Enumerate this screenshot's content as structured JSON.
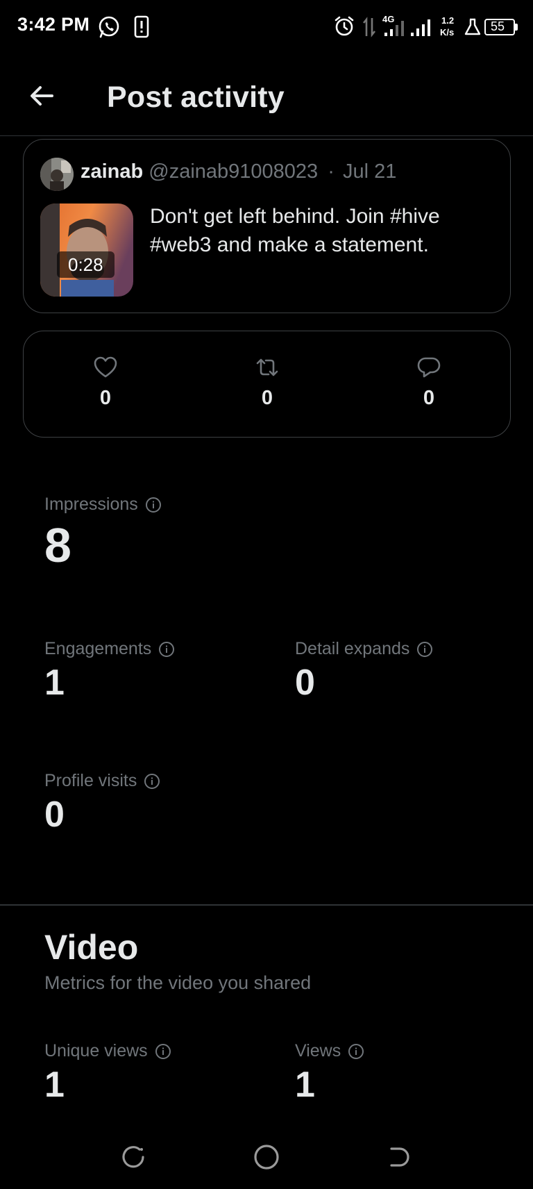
{
  "status_bar": {
    "time": "3:42 PM",
    "network": "4G",
    "speed_value": "1.2",
    "speed_unit": "K/s",
    "battery": "55",
    "icons": [
      "whatsapp-icon",
      "sim-alert-icon",
      "alarm-icon",
      "data-arrows-icon",
      "signal-icon",
      "signal-icon",
      "flask-icon",
      "battery-icon"
    ]
  },
  "header": {
    "title": "Post activity",
    "back_icon": "arrow-left-icon"
  },
  "post": {
    "author_name": "zainab",
    "handle": "@zainab91008023",
    "separator": "·",
    "date": "Jul 21",
    "video_duration": "0:28",
    "text": "Don't get left behind. Join #hive #web3 and make a statement."
  },
  "engagement": {
    "likes": "0",
    "reposts": "0",
    "replies": "0",
    "icons": [
      "heart-icon",
      "repost-icon",
      "reply-icon"
    ]
  },
  "metrics": {
    "impressions": {
      "label": "Impressions",
      "value": "8"
    },
    "engagements": {
      "label": "Engagements",
      "value": "1"
    },
    "detail_expands": {
      "label": "Detail expands",
      "value": "0"
    },
    "profile_visits": {
      "label": "Profile visits",
      "value": "0"
    }
  },
  "video_section": {
    "title": "Video",
    "subtitle": "Metrics for the video you shared",
    "unique_views": {
      "label": "Unique views",
      "value": "1"
    },
    "views": {
      "label": "Views",
      "value": "1"
    }
  },
  "nav_bar": {
    "icons": [
      "recents-icon",
      "home-circle-icon",
      "back-nav-icon"
    ]
  },
  "colors": {
    "background": "#000000",
    "primary_text": "#e7e9ea",
    "secondary_text": "#71767b",
    "border": "#3e4144"
  }
}
